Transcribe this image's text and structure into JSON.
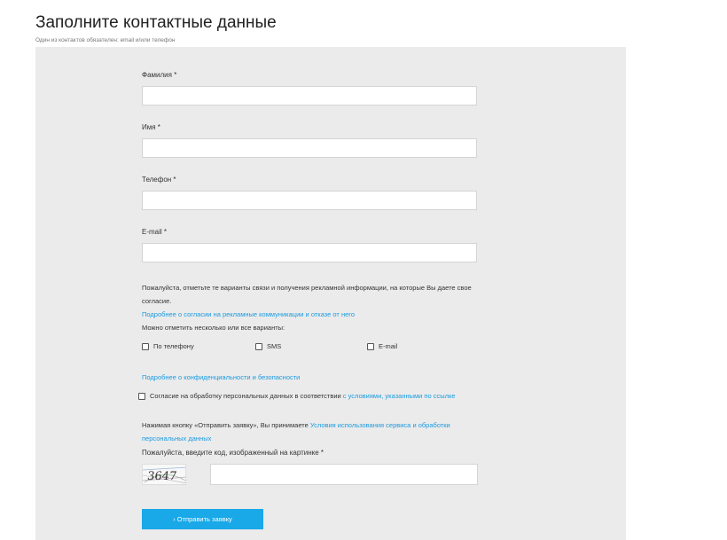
{
  "header": {
    "title": "Заполните контактные данные",
    "subtitle": "Один из контактов обязателен: email и/или телефон"
  },
  "fields": {
    "lastname": {
      "label": "Фамилия *",
      "value": ""
    },
    "firstname": {
      "label": "Имя *",
      "value": ""
    },
    "phone": {
      "label": "Телефон *",
      "value": ""
    },
    "email": {
      "label": "E-mail *",
      "value": ""
    }
  },
  "consent": {
    "text_line1": "Пожалуйста, отметьте те варианты связи и получения рекламной информации, на которые Вы даете свое",
    "text_line2": "согласие.",
    "link": "Подробнее о согласии на рекламные коммуникации и отказе от него",
    "options_note": "Можно отметить несколько или все варианты:",
    "options": [
      {
        "label": "По телефону",
        "checked": false
      },
      {
        "label": "SMS",
        "checked": false
      },
      {
        "label": "E-mail",
        "checked": false
      }
    ]
  },
  "privacy_link": "Подробнее о конфиденциальности и безопасности",
  "personal_data": {
    "text": "Согласие на обработку персональных данных в соответствии ",
    "link": "с условиями, указанными по ссылке",
    "checked": false
  },
  "terms": {
    "text": "Нажимая кнопку «Отправить заявку», Вы принимаете ",
    "link_line1": "Условия использования сервиса и обработки",
    "link_line2": "персональных данных"
  },
  "captcha": {
    "label": "Пожалуйста, введите код, изображенный на картинке *",
    "image_text": "3647",
    "value": ""
  },
  "submit": {
    "label": "› Отправить заявку"
  },
  "colors": {
    "panel": "#ebebeb",
    "accent": "#19a8e8",
    "link": "#1a9be0"
  }
}
